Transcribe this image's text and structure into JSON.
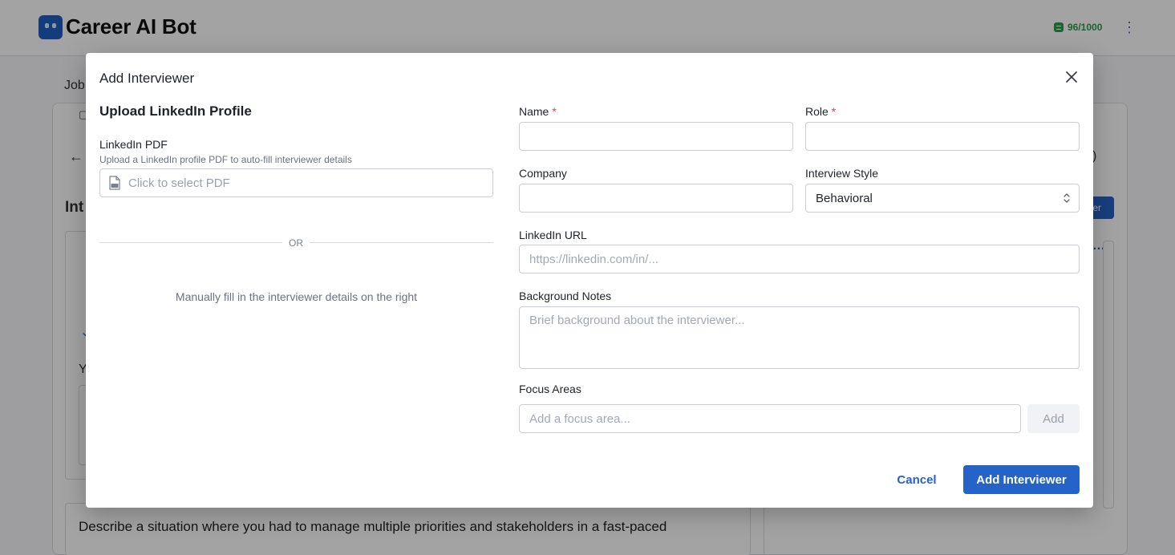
{
  "app": {
    "title": "Career AI Bot",
    "credits": "96/1000",
    "background": {
      "breadcrumb_fragment": "Job",
      "section_fragment": "Int",
      "letter_fragment": "Y",
      "tab_suffix": ")",
      "button_fragment": "er",
      "question_text": "Describe a situation where you had to manage multiple priorities and stakeholders in a fast-paced"
    }
  },
  "modal": {
    "title": "Add Interviewer",
    "left": {
      "heading": "Upload LinkedIn Profile",
      "pdf_label": "LinkedIn PDF",
      "pdf_help": "Upload a LinkedIn profile PDF to auto-fill interviewer details",
      "pdf_placeholder": "Click to select PDF",
      "or_label": "OR",
      "manual_text": "Manually fill in the interviewer details on the right"
    },
    "form": {
      "name": {
        "label": "Name",
        "required_mark": "*",
        "value": "",
        "placeholder": ""
      },
      "role": {
        "label": "Role",
        "required_mark": "*",
        "value": "",
        "placeholder": ""
      },
      "company": {
        "label": "Company",
        "value": "",
        "placeholder": ""
      },
      "interview_style": {
        "label": "Interview Style",
        "selected": "Behavioral"
      },
      "linkedin_url": {
        "label": "LinkedIn URL",
        "value": "",
        "placeholder": "https://linkedin.com/in/..."
      },
      "background_notes": {
        "label": "Background Notes",
        "value": "",
        "placeholder": "Brief background about the interviewer..."
      },
      "focus_areas": {
        "label": "Focus Areas",
        "value": "",
        "placeholder": "Add a focus area...",
        "add_label": "Add"
      }
    },
    "actions": {
      "cancel_label": "Cancel",
      "submit_label": "Add Interviewer"
    }
  },
  "colors": {
    "primary": "#2563c9",
    "required": "#d64545",
    "credits": "#2e9a4d"
  }
}
